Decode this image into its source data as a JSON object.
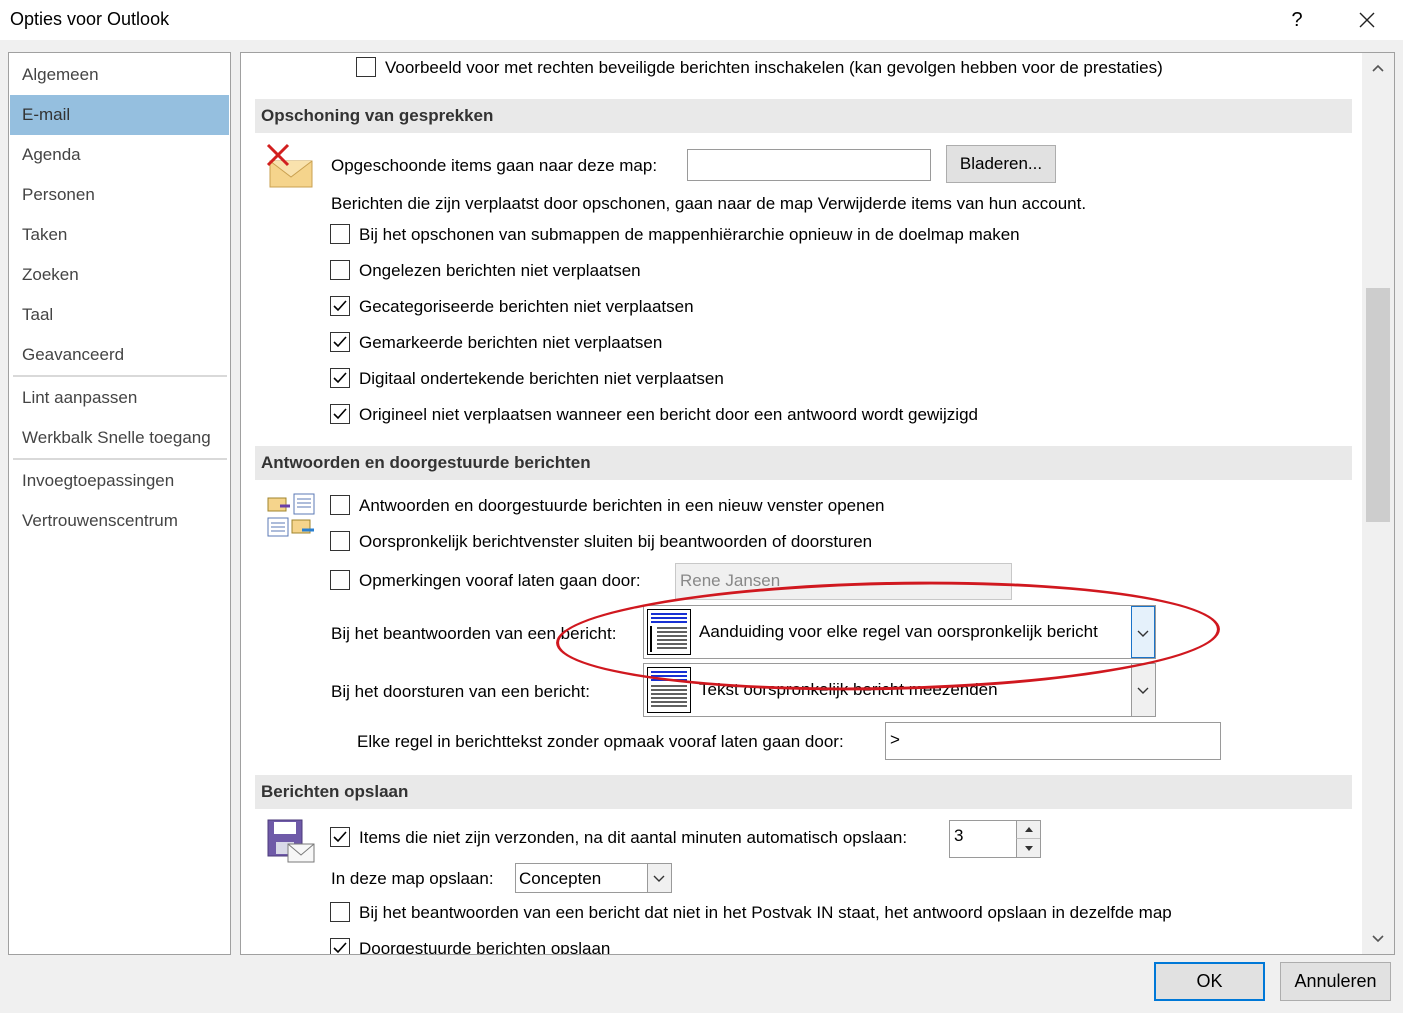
{
  "window": {
    "title": "Opties voor Outlook",
    "help": "?",
    "close_icon": "close-icon"
  },
  "sidebar": {
    "items": [
      {
        "label": "Algemeen"
      },
      {
        "label": "E-mail"
      },
      {
        "label": "Agenda"
      },
      {
        "label": "Personen"
      },
      {
        "label": "Taken"
      },
      {
        "label": "Zoeken"
      },
      {
        "label": "Taal"
      },
      {
        "label": "Geavanceerd"
      },
      {
        "label": "Lint aanpassen"
      },
      {
        "label": "Werkbalk Snelle toegang"
      },
      {
        "label": "Invoegtoepassingen"
      },
      {
        "label": "Vertrouwenscentrum"
      }
    ],
    "selected": "E-mail"
  },
  "top": {
    "preview_rights": "Voorbeeld voor met rechten beveiligde berichten inschakelen (kan gevolgen hebben voor de prestaties)"
  },
  "cleanup": {
    "header": "Opschoning van gesprekken",
    "folder_label": "Opgeschoonde items gaan naar deze map:",
    "folder_value": "",
    "browse_label": "Bladeren...",
    "info": "Berichten die zijn verplaatst door opschonen, gaan naar de map Verwijderde items van hun account.",
    "options": [
      {
        "label": "Bij het opschonen van submappen de mappenhiërarchie opnieuw in de doelmap maken",
        "checked": false
      },
      {
        "label": "Ongelezen berichten niet verplaatsen",
        "checked": false
      },
      {
        "label": "Gecategoriseerde berichten niet verplaatsen",
        "checked": true
      },
      {
        "label": "Gemarkeerde berichten niet verplaatsen",
        "checked": true
      },
      {
        "label": "Digitaal ondertekende berichten niet verplaatsen",
        "checked": true
      },
      {
        "label": "Origineel niet verplaatsen wanneer een bericht door een antwoord wordt gewijzigd",
        "checked": true
      }
    ]
  },
  "replies": {
    "header": "Antwoorden en doorgestuurde berichten",
    "options": [
      {
        "label": "Antwoorden en doorgestuurde berichten in een nieuw venster openen",
        "checked": false
      },
      {
        "label": "Oorspronkelijk berichtvenster sluiten bij beantwoorden of doorsturen",
        "checked": false
      },
      {
        "label": "Opmerkingen vooraf laten gaan door:",
        "checked": false
      }
    ],
    "preface_name": "Rene Jansen",
    "reply_label": "Bij het beantwoorden van een bericht:",
    "reply_value": "Aanduiding voor elke regel van oorspronkelijk bericht",
    "forward_label": "Bij het doorsturen van een bericht:",
    "forward_value": "Tekst oorspronkelijk bericht meezenden",
    "prefix_label": "Elke regel in berichttekst zonder opmaak vooraf laten gaan door:",
    "prefix_value": ">"
  },
  "save": {
    "header": "Berichten opslaan",
    "autosave_label": "Items die niet zijn verzonden, na dit aantal minuten automatisch opslaan:",
    "autosave_checked": true,
    "autosave_minutes": "3",
    "folder_label": "In deze map opslaan:",
    "folder_value": "Concepten",
    "reply_save_label": "Bij het beantwoorden van een bericht dat niet in het Postvak IN staat, het antwoord opslaan in dezelfde map",
    "reply_save_checked": false,
    "forward_save_label": "Doorgestuurde berichten opslaan",
    "forward_save_checked": true
  },
  "footer": {
    "ok": "OK",
    "cancel": "Annuleren"
  },
  "colors": {
    "selected_nav": "#95bfdf",
    "annotation": "#d0181f",
    "focus": "#0078d7"
  }
}
